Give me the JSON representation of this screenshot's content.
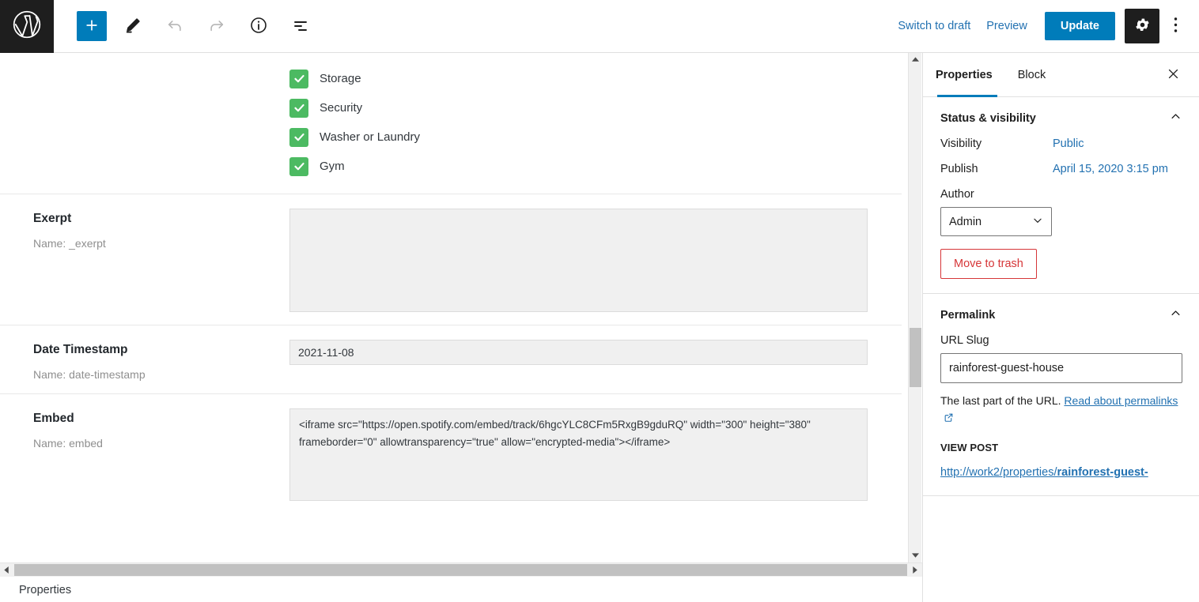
{
  "topbar": {
    "logo_icon": "wordpress-logo-icon",
    "add_block_label": "+",
    "tools": [
      {
        "name": "add-block-button",
        "icon": "plus-icon"
      },
      {
        "name": "edit-tool-button",
        "icon": "pencil-icon"
      },
      {
        "name": "undo-button",
        "icon": "undo-arrow-icon"
      },
      {
        "name": "redo-button",
        "icon": "redo-arrow-icon"
      },
      {
        "name": "details-button",
        "icon": "info-circle-icon"
      },
      {
        "name": "list-view-button",
        "icon": "list-view-icon"
      }
    ],
    "switch_to_draft": "Switch to draft",
    "preview": "Preview",
    "update": "Update",
    "settings_icon": "gear-icon",
    "more_options_icon": "kebab-menu-icon"
  },
  "main": {
    "checkboxes": [
      {
        "label": "Storage",
        "checked": true
      },
      {
        "label": "Security",
        "checked": true
      },
      {
        "label": "Washer or Laundry",
        "checked": true
      },
      {
        "label": "Gym",
        "checked": true
      }
    ],
    "fields": [
      {
        "title": "Exerpt",
        "name_line": "Name: _exerpt",
        "type": "textarea",
        "value": "",
        "size": "large"
      },
      {
        "title": "Date Timestamp",
        "name_line": "Name: date-timestamp",
        "type": "text",
        "value": "2021-11-08"
      },
      {
        "title": "Embed",
        "name_line": "Name: embed",
        "type": "textarea",
        "value": "<iframe src=\"https://open.spotify.com/embed/track/6hgcYLC8CFm5RxgB9gduRQ\" width=\"300\" height=\"380\" frameborder=\"0\" allowtransparency=\"true\" allow=\"encrypted-media\"></iframe>",
        "size": "medium"
      }
    ]
  },
  "statusbar": {
    "label": "Properties"
  },
  "sidebar": {
    "tabs": [
      {
        "label": "Properties",
        "active": true
      },
      {
        "label": "Block",
        "active": false
      }
    ],
    "close_icon": "close-x-icon",
    "status_panel": {
      "title": "Status & visibility",
      "collapse_icon": "chevron-up-icon",
      "visibility_label": "Visibility",
      "visibility_value": "Public",
      "publish_label": "Publish",
      "publish_value": "April 15, 2020 3:15 pm",
      "author_label": "Author",
      "author_value": "Admin",
      "author_dropdown_icon": "chevron-down-icon",
      "trash_label": "Move to trash"
    },
    "permalink_panel": {
      "title": "Permalink",
      "collapse_icon": "chevron-up-icon",
      "slug_label": "URL Slug",
      "slug_value": "rainforest-guest-house",
      "help_text": "The last part of the URL.",
      "help_link": "Read about permalinks",
      "external_icon": "external-link-icon",
      "view_post_label": "VIEW POST",
      "view_post_url_prefix": "http://work2/properties/",
      "view_post_url_slug": "rainforest-guest-"
    }
  },
  "colors": {
    "accent_blue": "#007cba",
    "link_blue": "#2271b1",
    "dark": "#1e1e1e",
    "green_check": "#4cba62",
    "danger_red": "#d63638"
  }
}
